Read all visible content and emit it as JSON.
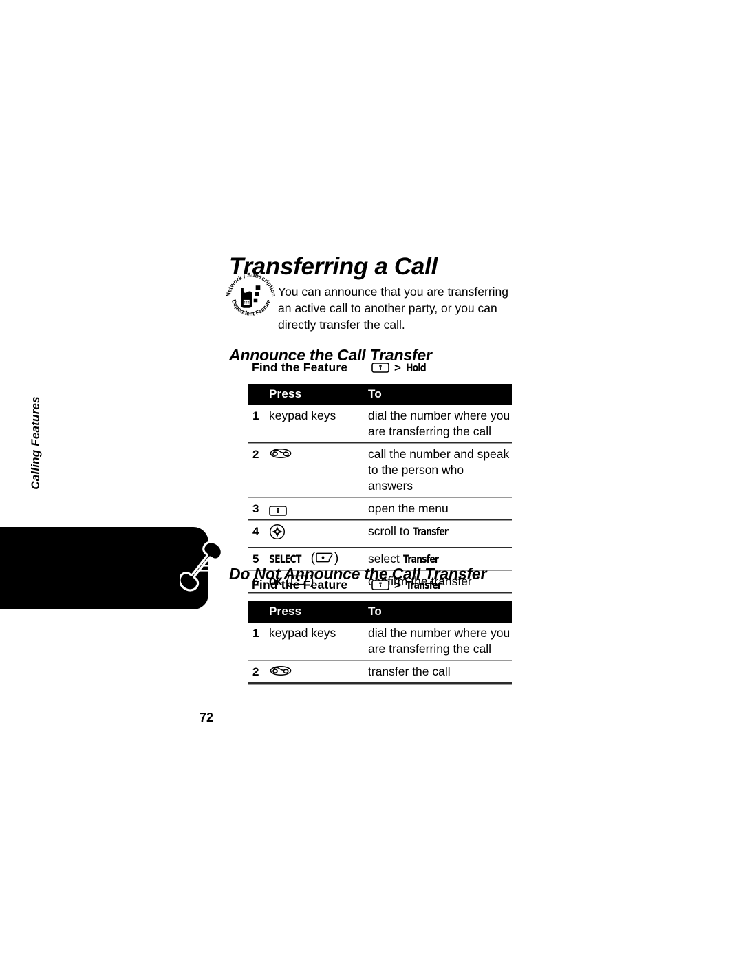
{
  "document": {
    "title": "Transferring a Call",
    "page_number": "72",
    "sidebar_label": "Calling Features",
    "sidebar_icon": "phone-handset-icon"
  },
  "intro": {
    "badge": {
      "top_arc": "Network / Subscription",
      "bottom_arc": "Dependent Feature",
      "icon": "network-dependent-feature-icon"
    },
    "text": "You can announce that you are transferring an active call to another party, or you can directly transfer the call."
  },
  "sections": [
    {
      "title": "Announce the Call Transfer",
      "find_the_feature": {
        "label": "Find the Feature",
        "key_icon": "menu-key-icon",
        "separator": ">",
        "menu_item": "Hold"
      },
      "table": {
        "headers": {
          "num": "",
          "press": "Press",
          "to": "To"
        },
        "rows": [
          {
            "num": "1",
            "press_text": "keypad keys",
            "press_icon": "",
            "press_suffix": "",
            "to": "dial the number where you are transferring the call",
            "to_bold": ""
          },
          {
            "num": "2",
            "press_text": "",
            "press_icon": "send-key-icon",
            "press_suffix": "",
            "to": "call the number and speak to the person who answers",
            "to_bold": ""
          },
          {
            "num": "3",
            "press_text": "",
            "press_icon": "menu-key-icon",
            "press_suffix": "",
            "to": "open the menu",
            "to_bold": ""
          },
          {
            "num": "4",
            "press_text": "",
            "press_icon": "navigation-key-icon",
            "press_suffix": "",
            "to": "scroll to ",
            "to_bold": "Transfer"
          },
          {
            "num": "5",
            "press_text": "SELECT",
            "press_icon": "left-soft-key-icon",
            "press_suffix": "paren",
            "to": "select ",
            "to_bold": "Transfer"
          },
          {
            "num": "6",
            "press_text": "OK",
            "press_icon": "left-soft-key-icon",
            "press_suffix": "paren",
            "to": "confirm the transfer",
            "to_bold": ""
          }
        ]
      }
    },
    {
      "title": "Do Not Announce the Call Transfer",
      "find_the_feature": {
        "label": "Find the Feature",
        "key_icon": "menu-key-icon",
        "separator": ">",
        "menu_item": "Transfer"
      },
      "table": {
        "headers": {
          "num": "",
          "press": "Press",
          "to": "To"
        },
        "rows": [
          {
            "num": "1",
            "press_text": "keypad keys",
            "press_icon": "",
            "press_suffix": "",
            "to": "dial the number where you are transferring the call",
            "to_bold": ""
          },
          {
            "num": "2",
            "press_text": "",
            "press_icon": "send-key-icon",
            "press_suffix": "",
            "to": "transfer the call",
            "to_bold": ""
          }
        ]
      }
    }
  ],
  "colors": {
    "ink": "#000000",
    "paper": "#ffffff",
    "rule_gray": "#9a9a9a",
    "rule_dark": "#2b2b2b"
  }
}
